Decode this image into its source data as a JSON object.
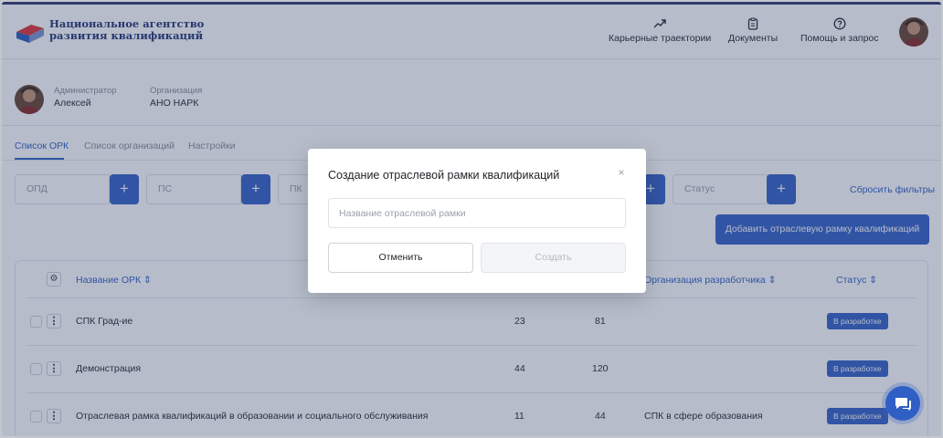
{
  "header": {
    "brand_line1": "Национальное агентство",
    "brand_line2": "развития квалификаций",
    "nav": [
      {
        "label": "Карьерные траектории",
        "icon": "trend-up-icon"
      },
      {
        "label": "Документы",
        "icon": "clipboard-icon"
      },
      {
        "label": "Помощь и запрос",
        "icon": "help-circle-icon"
      }
    ]
  },
  "user": {
    "role_label": "Администратор",
    "role_value": "Алексей",
    "org_label": "Организация",
    "org_value": "АНО НАРК"
  },
  "tabs": [
    {
      "label": "Список ОРК",
      "active": true
    },
    {
      "label": "Список организаций",
      "active": false
    },
    {
      "label": "Настройки",
      "active": false
    }
  ],
  "filters": {
    "opd": "ОПД",
    "ps": "ПС",
    "pk": "ПК",
    "status": "Статус",
    "plus": "+",
    "reset": "Сбросить фильтры",
    "add_button": "Добавить отраслевую рамку квалификаций"
  },
  "table": {
    "gear": "⚙",
    "headers": {
      "name": "Название ОРК ⇕",
      "org": "Организация разработчика ⇕",
      "status": "Статус ⇕"
    },
    "kebab": "⋮",
    "rows": [
      {
        "name": "СПК Град-ие",
        "col3": "23",
        "col4": "81",
        "org": "",
        "status": "В разработке"
      },
      {
        "name": "Демонстрация",
        "col3": "44",
        "col4": "120",
        "org": "",
        "status": "В разработке"
      },
      {
        "name": "Отраслевая рамка квалификаций в образовании и социального обслуживания",
        "col3": "11",
        "col4": "44",
        "org": "СПК в сфере образования",
        "status": "В разработке"
      }
    ]
  },
  "modal": {
    "title": "Создание отраслевой рамки квалификаций",
    "close": "×",
    "input_placeholder": "Название отраслевой рамки",
    "input_value": "",
    "cancel": "Отменить",
    "create": "Создать"
  },
  "colors": {
    "accent": "#3a64c8",
    "brand": "#2b3a7a",
    "overlay": "rgba(34,52,92,0.33)"
  }
}
